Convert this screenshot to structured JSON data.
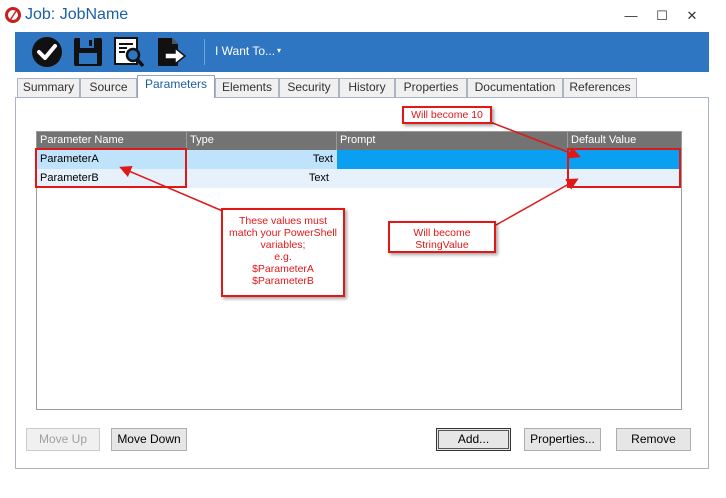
{
  "window": {
    "title": "Job: JobName",
    "controls": {
      "minimize": "—",
      "maximize": "☐",
      "close": "✕"
    }
  },
  "ribbon": {
    "accent": "#2e76c2",
    "buttons": [
      {
        "name": "check-icon"
      },
      {
        "name": "save-icon"
      },
      {
        "name": "preview-icon"
      },
      {
        "name": "export-icon"
      }
    ],
    "menu_label": "I Want To...",
    "menu_caret": "▾"
  },
  "tabs": [
    {
      "label": "Summary"
    },
    {
      "label": "Source"
    },
    {
      "label": "Parameters",
      "active": true
    },
    {
      "label": "Elements"
    },
    {
      "label": "Security"
    },
    {
      "label": "History"
    },
    {
      "label": "Properties"
    },
    {
      "label": "Documentation"
    },
    {
      "label": "References"
    }
  ],
  "grid": {
    "columns": [
      "Parameter Name",
      "Type",
      "Prompt",
      "Default Value"
    ],
    "rows": [
      {
        "name": "ParameterA",
        "type": "Text",
        "prompt": "",
        "default": ""
      },
      {
        "name": "ParameterB",
        "type": "Text",
        "prompt": "",
        "default": ""
      }
    ],
    "selected_row_color": "#0a9ff0"
  },
  "annotations": {
    "top_callout": "Will become 10",
    "left_callout": [
      "These values must",
      "match your PowerShell",
      "variables;",
      "e.g.",
      "$ParameterA",
      "$ParameterB"
    ],
    "right_callout": [
      "Will become",
      "StringValue"
    ],
    "color": "#e01818"
  },
  "buttons": {
    "move_up": "Move Up",
    "move_down": "Move Down",
    "add": "Add...",
    "properties": "Properties...",
    "remove": "Remove"
  }
}
